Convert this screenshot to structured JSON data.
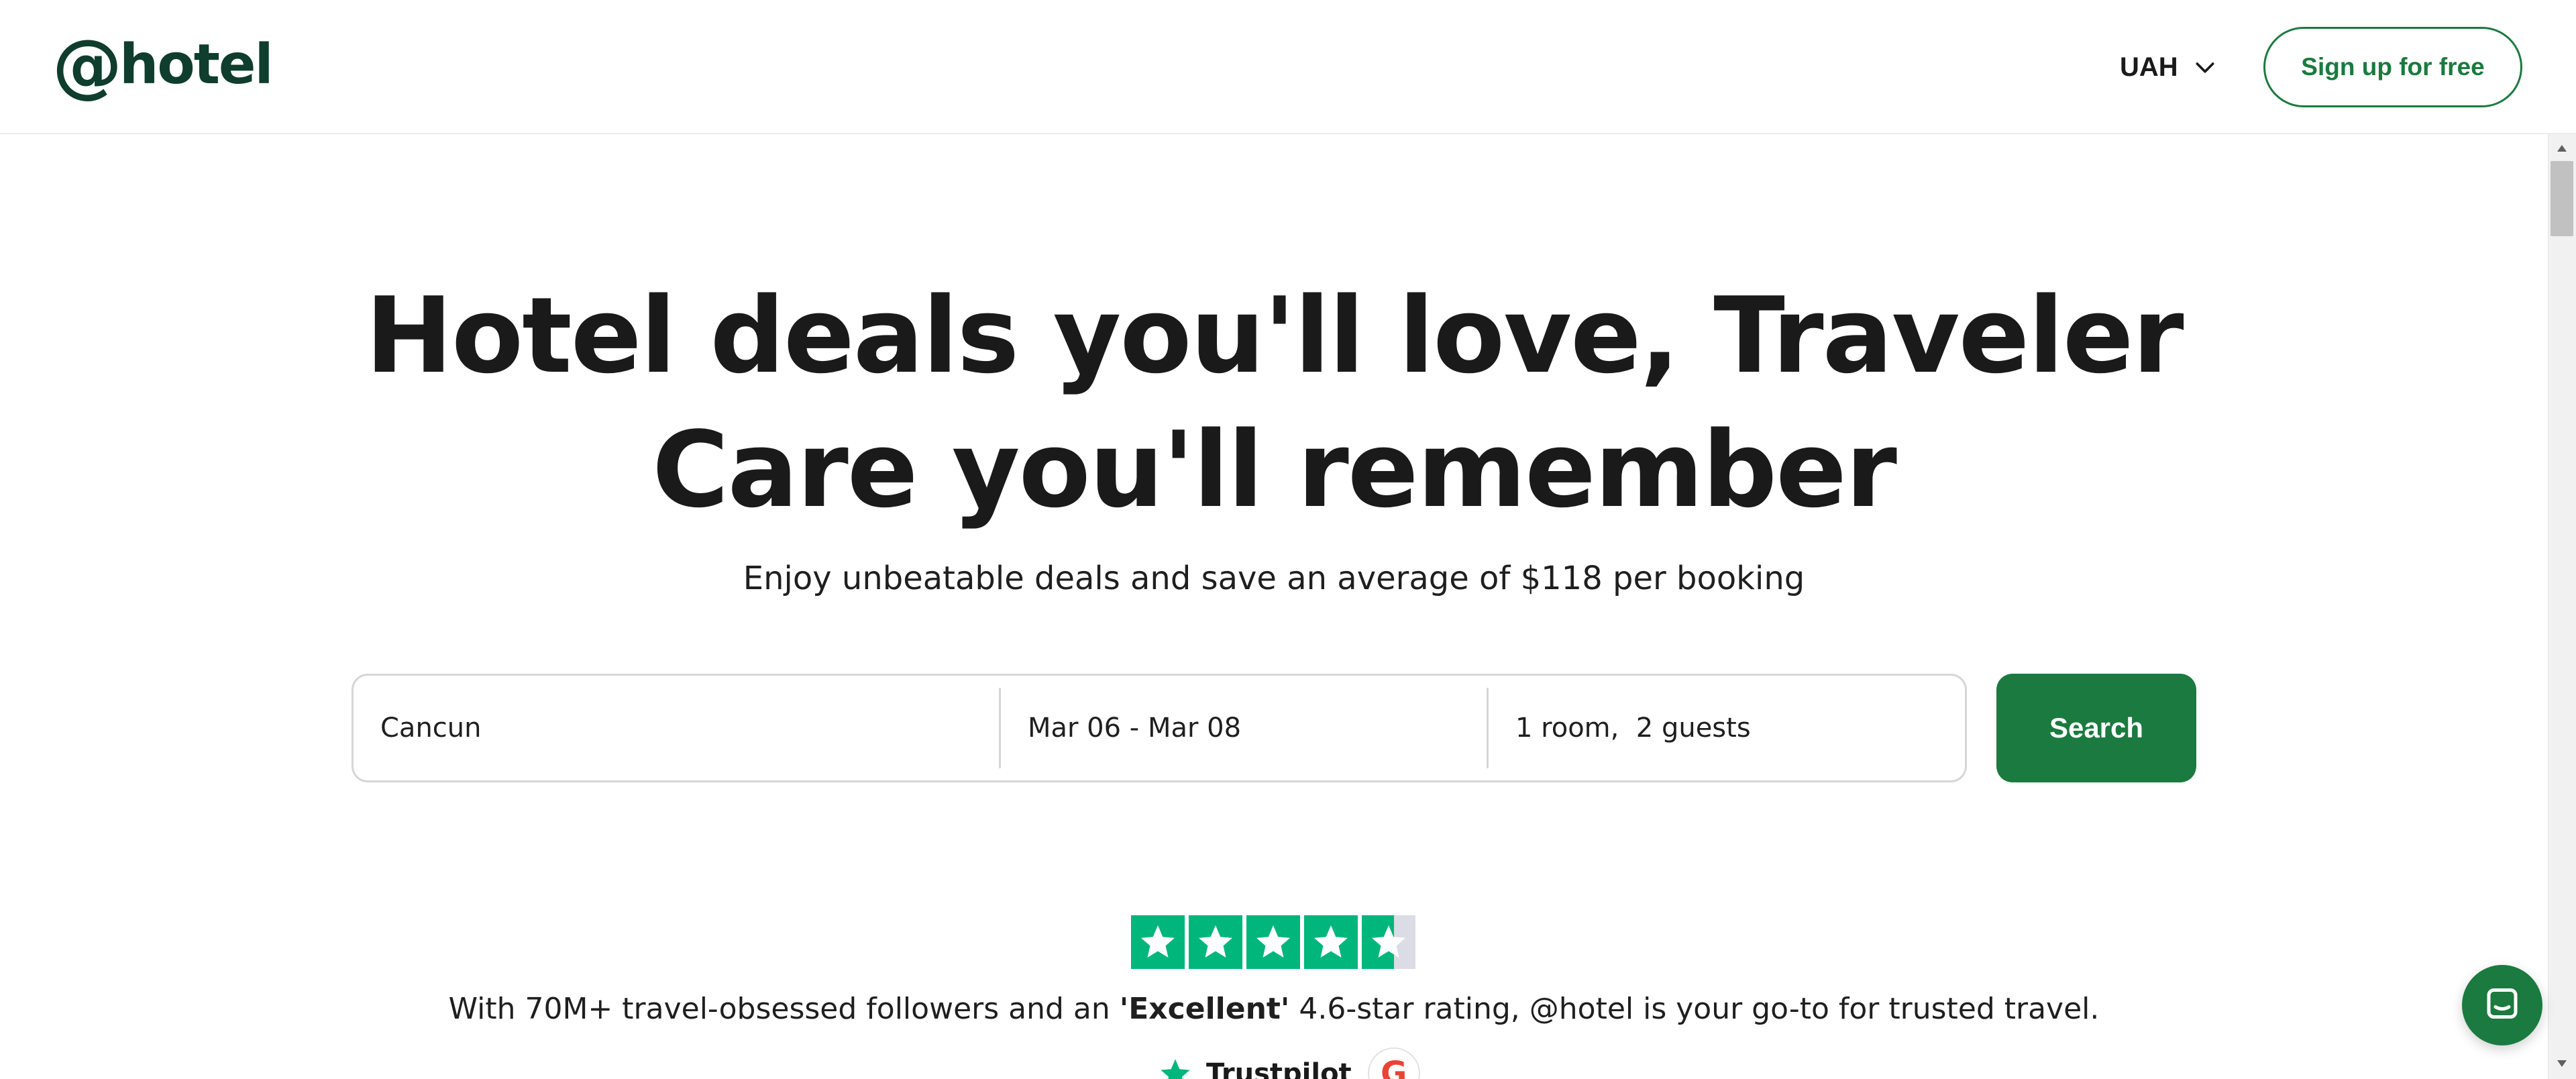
{
  "header": {
    "logo_at": "@",
    "logo_word": "hotel",
    "currency": "UAH",
    "signup_label": "Sign up for free"
  },
  "hero": {
    "headline_line1": "Hotel deals you'll love, Traveler",
    "headline_line2": "Care you'll remember",
    "subtitle": "Enjoy unbeatable deals and save an average of $118 per booking"
  },
  "search": {
    "destination": "Cancun",
    "dates": "Mar 06 - Mar 08",
    "guests": "1 room,  2 guests",
    "button_label": "Search"
  },
  "rating": {
    "stars_value": 4.6,
    "stars_max": 5,
    "text_before": "With 70M+ travel-obsessed followers and an ",
    "text_bold": "'Excellent'",
    "text_after": " 4.6-star rating, @hotel is your go-to for trusted travel.",
    "trustpilot_label": "Trustpilot",
    "google_letter": "G"
  },
  "colors": {
    "brand_green": "#1b7a3f",
    "logo_green": "#0f3d2e",
    "trustpilot_green": "#00b67a"
  },
  "icons": {
    "currency_chevron": "chevron-down-icon",
    "chat": "chat-icon",
    "trustpilot_star": "star-icon"
  }
}
